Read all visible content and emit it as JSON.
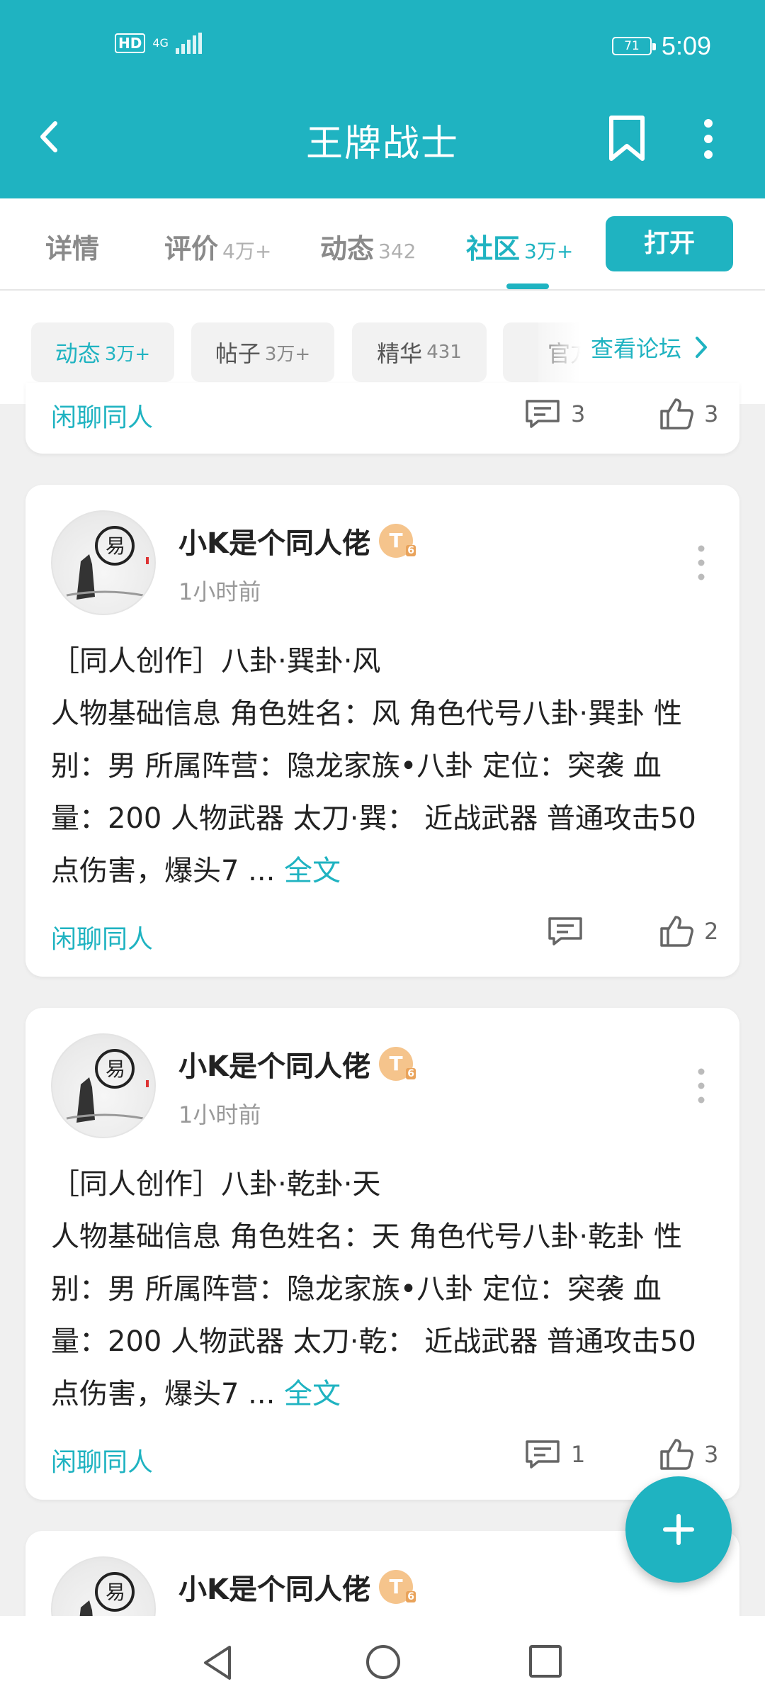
{
  "status_bar": {
    "left_icons": [
      "HD",
      "4G"
    ],
    "battery": "71",
    "time": "5:09"
  },
  "title_bar": {
    "title": "王牌战士",
    "icons": [
      "back-arrow",
      "bookmark",
      "more-vertical"
    ]
  },
  "tabs": [
    {
      "label": "详情",
      "count": ""
    },
    {
      "label": "评价",
      "count": "4万+"
    },
    {
      "label": "动态",
      "count": "342"
    },
    {
      "label": "社区",
      "count": "3万+",
      "active": true
    }
  ],
  "open_button": "打开",
  "filters": [
    {
      "label": "动态",
      "count": "3万+",
      "active": true
    },
    {
      "label": "帖子",
      "count": "3万+"
    },
    {
      "label": "精华",
      "count": "431"
    },
    {
      "label": "官方",
      "count": ""
    }
  ],
  "view_forum": "查看论坛",
  "partial_post": {
    "tag": "闲聊同人",
    "comments": "3",
    "likes": "3"
  },
  "posts": [
    {
      "author": "小K是个同人佬",
      "badge": "T",
      "badge_level": "6",
      "time": "1小时前",
      "title": "［同人创作］八卦·巽卦·风",
      "excerpt": "人物基础信息 角色姓名：风 角色代号八卦·巽卦 性别：男 所属阵营：隐龙家族•八卦 定位：突袭 血量：200 人物武器 太刀·巽： 近战武器 普通攻击50点伤害，爆头7 ...",
      "more_label": "全文",
      "tag": "闲聊同人",
      "comments": "",
      "likes": "2"
    },
    {
      "author": "小K是个同人佬",
      "badge": "T",
      "badge_level": "6",
      "time": "1小时前",
      "title": "［同人创作］八卦·乾卦·天",
      "excerpt": "人物基础信息 角色姓名：天 角色代号八卦·乾卦 性别：男 所属阵营：隐龙家族•八卦 定位：突袭 血量：200 人物武器 太刀·乾： 近战武器 普通攻击50点伤害，爆头7 ...",
      "more_label": "全文",
      "tag": "闲聊同人",
      "comments": "1",
      "likes": "3"
    },
    {
      "author": "小K是个同人佬",
      "badge": "T",
      "badge_level": "6"
    }
  ],
  "colors": {
    "accent": "#1fb3c1",
    "background": "#f0f0f0"
  }
}
